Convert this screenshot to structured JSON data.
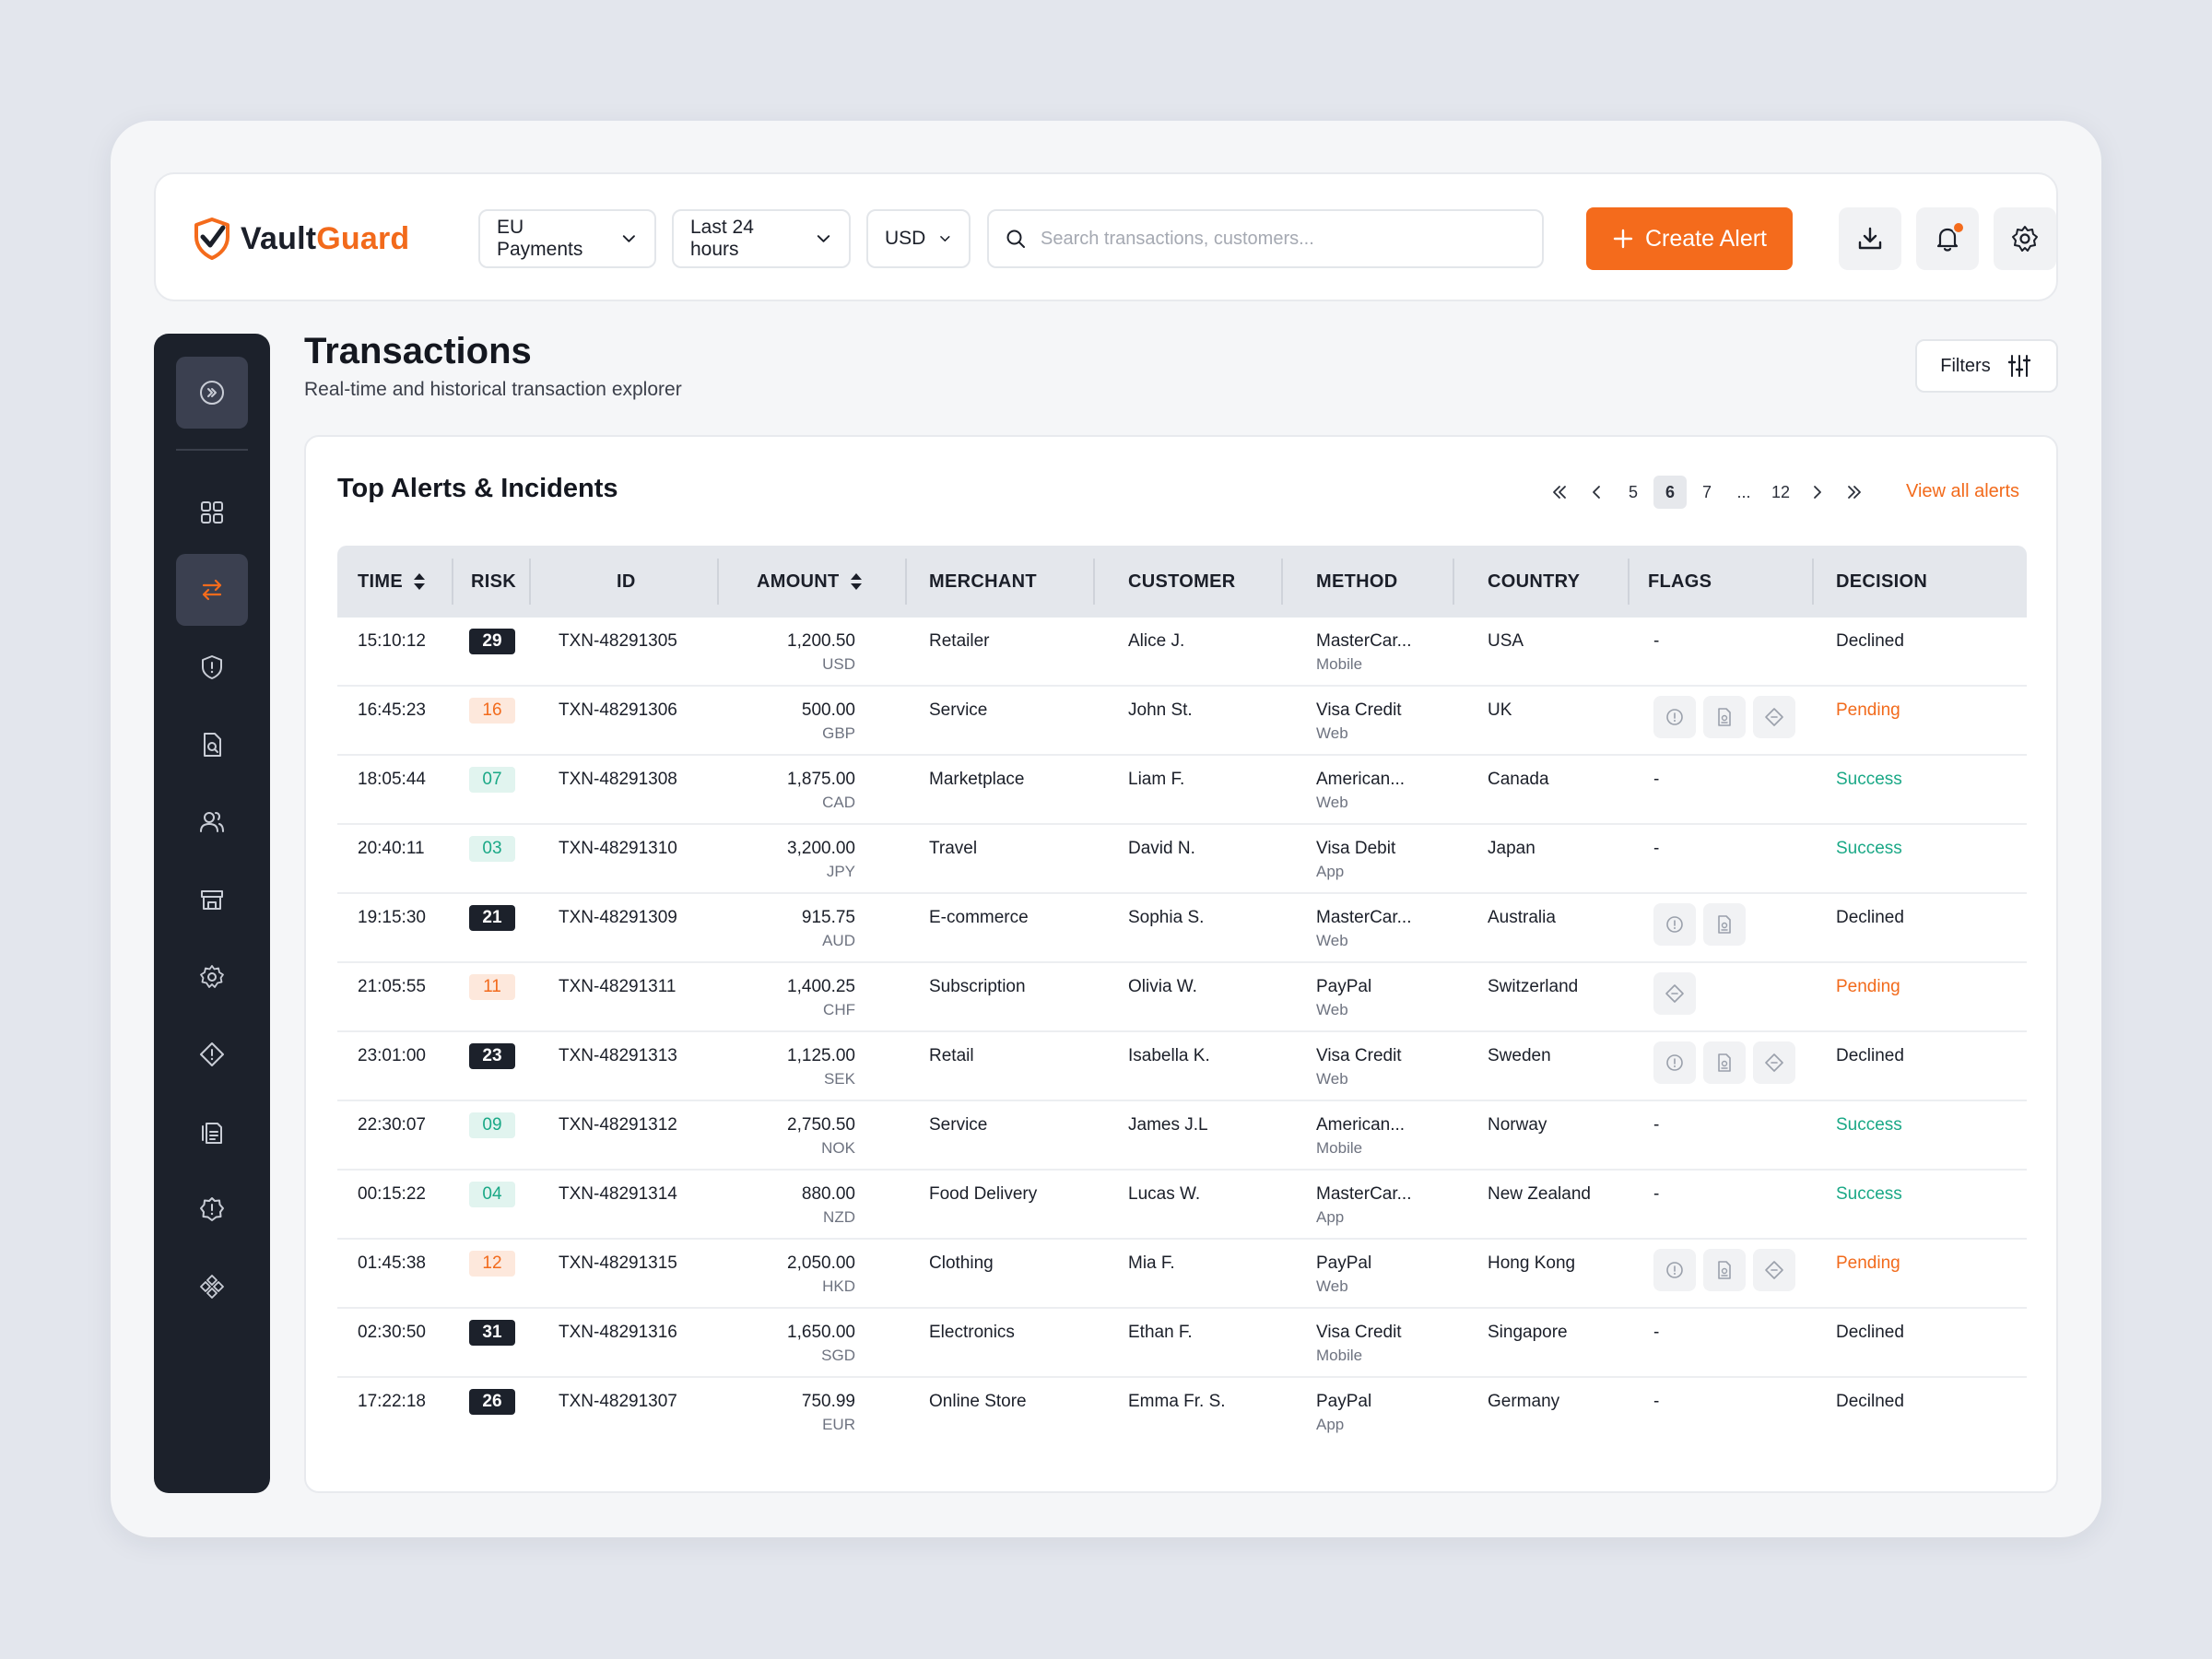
{
  "brand": {
    "name_a": "Vault",
    "name_b": "Guard"
  },
  "header": {
    "selects": [
      {
        "label": "EU Payments"
      },
      {
        "label": "Last 24 hours"
      },
      {
        "label": "USD"
      }
    ],
    "search_placeholder": "Search transactions, customers...",
    "create_label": "Create Alert"
  },
  "page": {
    "title": "Transactions",
    "subtitle": "Real-time and historical transaction explorer",
    "filters_label": "Filters"
  },
  "card": {
    "title": "Top Alerts & Incidents",
    "view_all": "View all alerts",
    "pager": [
      "5",
      "6",
      "7",
      "...",
      "12"
    ],
    "current_page": "6"
  },
  "table": {
    "headers": {
      "time": "TIME",
      "risk": "RISK",
      "id": "ID",
      "amount": "AMOUNT",
      "merchant": "MERCHANT",
      "customer": "CUSTOMER",
      "method": "METHOD",
      "country": "COUNTRY",
      "flags": "FLAGS",
      "decision": "DECISION"
    },
    "rows": [
      {
        "time": "15:10:12",
        "risk": "29",
        "risk_level": "high",
        "id": "TXN-48291305",
        "amount": "1,200.50",
        "currency": "USD",
        "merchant": "Retailer",
        "customer": "Alice J.",
        "method": "MasterCar...",
        "channel": "Mobile",
        "country": "USA",
        "flags": [],
        "flags_text": "-",
        "decision": "Declined",
        "decision_type": "declined"
      },
      {
        "time": "16:45:23",
        "risk": "16",
        "risk_level": "med",
        "id": "TXN-48291306",
        "amount": "500.00",
        "currency": "GBP",
        "merchant": "Service",
        "customer": "John St.",
        "method": "Visa Credit",
        "channel": "Web",
        "country": "UK",
        "flags": [
          "info",
          "doc",
          "diamond"
        ],
        "flags_text": "",
        "decision": "Pending",
        "decision_type": "pending"
      },
      {
        "time": "18:05:44",
        "risk": "07",
        "risk_level": "low",
        "id": "TXN-48291308",
        "amount": "1,875.00",
        "currency": "CAD",
        "merchant": "Marketplace",
        "customer": "Liam F.",
        "method": "American...",
        "channel": "Web",
        "country": "Canada",
        "flags": [],
        "flags_text": "-",
        "decision": "Success",
        "decision_type": "success"
      },
      {
        "time": "20:40:11",
        "risk": "03",
        "risk_level": "low",
        "id": "TXN-48291310",
        "amount": "3,200.00",
        "currency": "JPY",
        "merchant": "Travel",
        "customer": "David N.",
        "method": "Visa Debit",
        "channel": "App",
        "country": "Japan",
        "flags": [],
        "flags_text": "-",
        "decision": "Success",
        "decision_type": "success"
      },
      {
        "time": "19:15:30",
        "risk": "21",
        "risk_level": "high",
        "id": "TXN-48291309",
        "amount": "915.75",
        "currency": "AUD",
        "merchant": "E-commerce",
        "customer": "Sophia S.",
        "method": "MasterCar...",
        "channel": "Web",
        "country": "Australia",
        "flags": [
          "info",
          "doc"
        ],
        "flags_text": "",
        "decision": "Declined",
        "decision_type": "declined"
      },
      {
        "time": "21:05:55",
        "risk": "11",
        "risk_level": "med",
        "id": "TXN-48291311",
        "amount": "1,400.25",
        "currency": "CHF",
        "merchant": "Subscription",
        "customer": "Olivia W.",
        "method": "PayPal",
        "channel": "Web",
        "country": "Switzerland",
        "flags": [
          "diamond"
        ],
        "flags_text": "",
        "decision": "Pending",
        "decision_type": "pending"
      },
      {
        "time": "23:01:00",
        "risk": "23",
        "risk_level": "high",
        "id": "TXN-48291313",
        "amount": "1,125.00",
        "currency": "SEK",
        "merchant": "Retail",
        "customer": "Isabella K.",
        "method": "Visa Credit",
        "channel": "Web",
        "country": "Sweden",
        "flags": [
          "info",
          "doc",
          "diamond"
        ],
        "flags_text": "",
        "decision": "Declined",
        "decision_type": "declined"
      },
      {
        "time": "22:30:07",
        "risk": "09",
        "risk_level": "low",
        "id": "TXN-48291312",
        "amount": "2,750.50",
        "currency": "NOK",
        "merchant": "Service",
        "customer": "James J.L",
        "method": "American...",
        "channel": "Mobile",
        "country": "Norway",
        "flags": [],
        "flags_text": "-",
        "decision": "Success",
        "decision_type": "success"
      },
      {
        "time": "00:15:22",
        "risk": "04",
        "risk_level": "low",
        "id": "TXN-48291314",
        "amount": "880.00",
        "currency": "NZD",
        "merchant": "Food Delivery",
        "customer": "Lucas W.",
        "method": "MasterCar...",
        "channel": "App",
        "country": "New Zealand",
        "flags": [],
        "flags_text": "-",
        "decision": "Success",
        "decision_type": "success"
      },
      {
        "time": "01:45:38",
        "risk": "12",
        "risk_level": "med",
        "id": "TXN-48291315",
        "amount": "2,050.00",
        "currency": "HKD",
        "merchant": "Clothing",
        "customer": "Mia F.",
        "method": "PayPal",
        "channel": "Web",
        "country": "Hong Kong",
        "flags": [
          "info",
          "doc",
          "diamond"
        ],
        "flags_text": "",
        "decision": "Pending",
        "decision_type": "pending"
      },
      {
        "time": "02:30:50",
        "risk": "31",
        "risk_level": "high",
        "id": "TXN-48291316",
        "amount": "1,650.00",
        "currency": "SGD",
        "merchant": "Electronics",
        "customer": "Ethan F.",
        "method": "Visa Credit",
        "channel": "Mobile",
        "country": "Singapore",
        "flags": [],
        "flags_text": "-",
        "decision": "Declined",
        "decision_type": "declined"
      },
      {
        "time": "17:22:18",
        "risk": "26",
        "risk_level": "high",
        "id": "TXN-48291307",
        "amount": "750.99",
        "currency": "EUR",
        "merchant": "Online Store",
        "customer": "Emma Fr. S.",
        "method": "PayPal",
        "channel": "App",
        "country": "Germany",
        "flags": [],
        "flags_text": "-",
        "decision": "Decilned",
        "decision_type": "declined"
      }
    ]
  },
  "icons": {
    "logo": "shield-check-icon",
    "sidebar": [
      "expand-icon",
      "dashboard-icon",
      "transactions-icon",
      "shield-alert-icon",
      "document-search-icon",
      "users-icon",
      "store-icon",
      "settings-gear-icon",
      "warning-diamond-icon",
      "reports-icon",
      "alert-badge-icon",
      "integrations-icon"
    ],
    "header": [
      "search-icon",
      "plus-icon",
      "download-icon",
      "bell-icon",
      "gear-icon"
    ]
  },
  "colors": {
    "accent": "#f46b1c",
    "sidebar": "#1c212b",
    "success": "#1aa886",
    "pending": "#f26a1b"
  }
}
